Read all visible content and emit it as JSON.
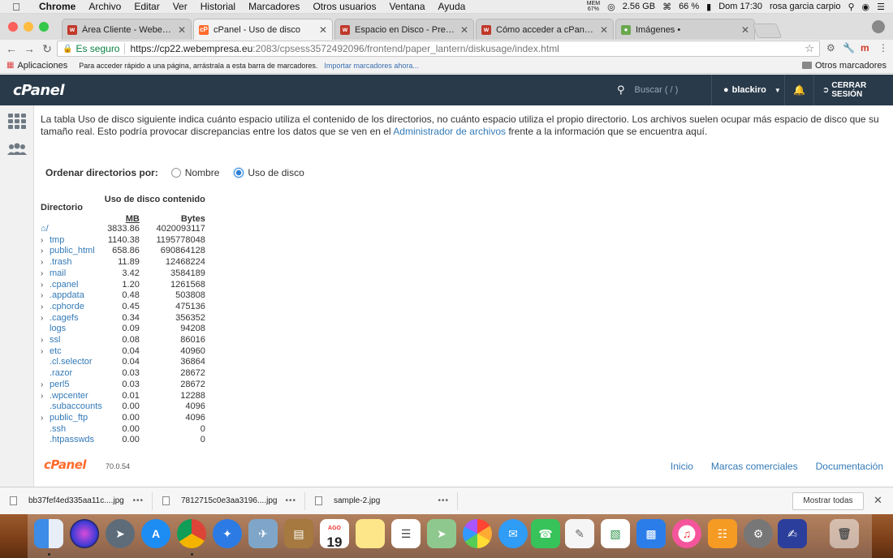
{
  "menubar": {
    "app": "Chrome",
    "items": [
      "Archivo",
      "Editar",
      "Ver",
      "Historial",
      "Marcadores",
      "Otros usuarios",
      "Ventana",
      "Ayuda"
    ],
    "mem_label": "MEM",
    "mem_value": "67%",
    "disk": "2.56 GB",
    "battery": "66 %",
    "clock": "Dom 17:30",
    "user": "rosa garcia carpio"
  },
  "tabs": [
    {
      "title": "Área Cliente - Webempresa Eu",
      "favicon": "webempresa-icon",
      "color": "#c0392b",
      "active": false
    },
    {
      "title": "cPanel - Uso de disco",
      "favicon": "cpanel-icon",
      "color": "#ff6c2c",
      "active": true
    },
    {
      "title": "Espacio en Disco - Preguntas F",
      "favicon": "webempresa-icon",
      "color": "#c0392b",
      "active": false
    },
    {
      "title": "Cómo acceder a cPanel - Preg",
      "favicon": "webempresa-icon",
      "color": "#c0392b",
      "active": false
    },
    {
      "title": "Imágenes •",
      "favicon": "images-icon",
      "color": "#6aa84f",
      "active": false
    }
  ],
  "address": {
    "secure_label": "Es seguro",
    "host": "https://cp22.webempresa.eu",
    "path": ":2083/cpsess3572492096/frontend/paper_lantern/diskusage/index.html"
  },
  "bookmarks": {
    "apps": "Aplicaciones",
    "hint": "Para acceder rápido a una página, arrástrala a esta barra de marcadores.",
    "import": "Importar marcadores ahora...",
    "other": "Otros marcadores"
  },
  "cpanel_header": {
    "logo": "cPanel",
    "search_placeholder": "Buscar ( / )",
    "user": "blackiro",
    "logout": "CERRAR SESIÓN"
  },
  "content": {
    "intro_1": "La tabla Uso de disco siguiente indica cuánto espacio utiliza el contenido de los directorios, no cuánto espacio utiliza el propio directorio. Los archivos suelen ocupar más espacio de disco que su tamaño real. Esto podría provocar discrepancias entre los datos que se ven en el ",
    "intro_link": "Administrador de archivos",
    "intro_2": " frente a la información que se encuentra aquí.",
    "sort_label": "Ordenar directorios por:",
    "sort_name": "Nombre",
    "sort_usage": "Uso de disco"
  },
  "table": {
    "dir_header": "Directorio",
    "group_header": "Uso de disco contenido",
    "mb_header": "MB",
    "bytes_header": "Bytes",
    "rows": [
      {
        "name": "/",
        "mb": "3833.86",
        "bytes": "4020093117",
        "expandable": false,
        "home": true
      },
      {
        "name": "tmp",
        "mb": "1140.38",
        "bytes": "1195778048",
        "expandable": true
      },
      {
        "name": "public_html",
        "mb": "658.86",
        "bytes": "690864128",
        "expandable": true
      },
      {
        "name": ".trash",
        "mb": "11.89",
        "bytes": "12468224",
        "expandable": true
      },
      {
        "name": "mail",
        "mb": "3.42",
        "bytes": "3584189",
        "expandable": true
      },
      {
        "name": ".cpanel",
        "mb": "1.20",
        "bytes": "1261568",
        "expandable": true
      },
      {
        "name": ".appdata",
        "mb": "0.48",
        "bytes": "503808",
        "expandable": true
      },
      {
        "name": ".cphorde",
        "mb": "0.45",
        "bytes": "475136",
        "expandable": true
      },
      {
        "name": ".cagefs",
        "mb": "0.34",
        "bytes": "356352",
        "expandable": true
      },
      {
        "name": "logs",
        "mb": "0.09",
        "bytes": "94208",
        "expandable": false
      },
      {
        "name": "ssl",
        "mb": "0.08",
        "bytes": "86016",
        "expandable": true
      },
      {
        "name": "etc",
        "mb": "0.04",
        "bytes": "40960",
        "expandable": true
      },
      {
        "name": ".cl.selector",
        "mb": "0.04",
        "bytes": "36864",
        "expandable": false
      },
      {
        "name": ".razor",
        "mb": "0.03",
        "bytes": "28672",
        "expandable": false
      },
      {
        "name": "perl5",
        "mb": "0.03",
        "bytes": "28672",
        "expandable": true
      },
      {
        "name": ".wpcenter",
        "mb": "0.01",
        "bytes": "12288",
        "expandable": true
      },
      {
        "name": ".subaccounts",
        "mb": "0.00",
        "bytes": "4096",
        "expandable": false
      },
      {
        "name": "public_ftp",
        "mb": "0.00",
        "bytes": "4096",
        "expandable": true
      },
      {
        "name": ".ssh",
        "mb": "0.00",
        "bytes": "0",
        "expandable": false
      },
      {
        "name": ".htpasswds",
        "mb": "0.00",
        "bytes": "0",
        "expandable": false
      }
    ]
  },
  "footer": {
    "logo": "cPanel",
    "version": "70.0.54",
    "links": [
      "Inicio",
      "Marcas comerciales",
      "Documentación"
    ]
  },
  "downloads": {
    "items": [
      "bb37fef4ed335aa11c....jpg",
      "7812715c0e3aa3196....jpg",
      "sample-2.jpg"
    ],
    "more": "•••",
    "show_all": "Mostrar todas"
  },
  "dock": {
    "calendar_month": "AGO",
    "calendar_day": "19",
    "colors": {
      "accent": "#337ab7",
      "header": "#293a4a",
      "cpanel_orange": "#ff6c2c"
    }
  }
}
